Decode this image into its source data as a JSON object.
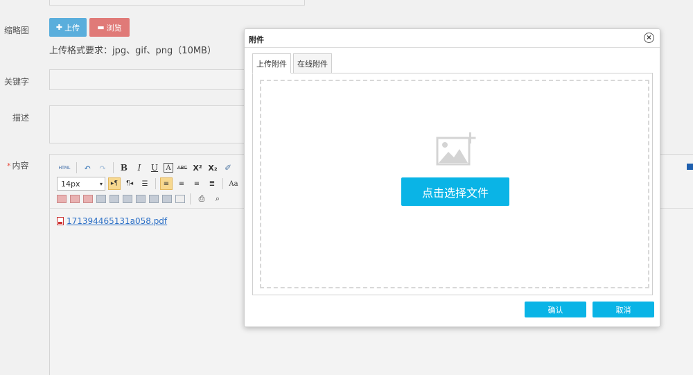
{
  "form": {
    "thumbnail_label": "缩略图",
    "upload_button": "上传",
    "browse_button": "浏览",
    "format_hint": "上传格式要求：jpg、gif、png（10MB）",
    "keywords_label": "关键字",
    "description_label": "描述",
    "content_required_mark": "*",
    "content_label": "内容"
  },
  "editor": {
    "html_button": "HTML",
    "bold": "B",
    "italic": "I",
    "underline": "U",
    "font_color": "A",
    "strikethrough": "ABC",
    "superscript": "X²",
    "subscript": "X₂",
    "font_size": "14px",
    "attachment_file": "171394465131a058.pdf"
  },
  "modal": {
    "title": "附件",
    "tabs": [
      {
        "label": "上传附件",
        "active": true
      },
      {
        "label": "在线附件",
        "active": false
      }
    ],
    "pick_file_button": "点击选择文件",
    "confirm_button": "确认",
    "cancel_button": "取消"
  },
  "colors": {
    "primary": "#0ab4e6",
    "upload_button": "#5aaedc",
    "browse_button": "#e07a78",
    "required": "#e84c3d"
  }
}
